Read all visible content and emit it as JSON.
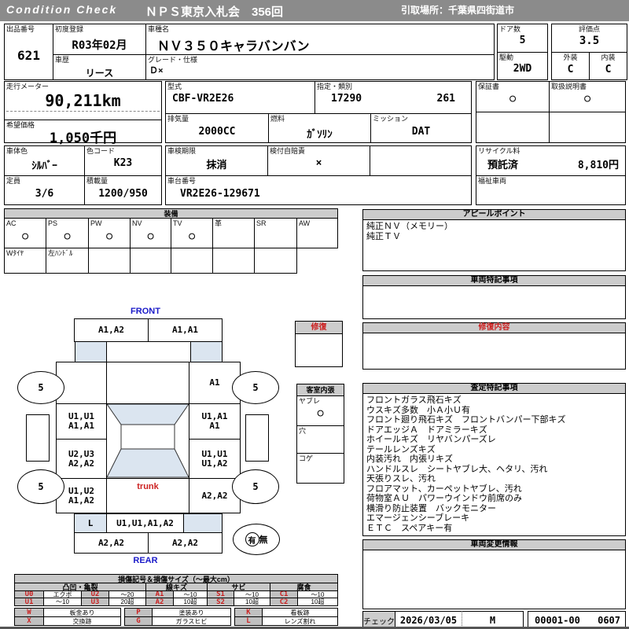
{
  "colors": {
    "header_bg": "#8b8b8b",
    "section_header_bg": "#cccccc",
    "diagram_highlight": "#dbe5f0",
    "accent_red": "#cc2222",
    "accent_blue": "#1a1ac8"
  },
  "header": {
    "logo": "Condition Check",
    "title": "ＮＰＳ東京入札会　356回",
    "pickup": "引取場所：千葉県四街道市"
  },
  "info": {
    "lot_no_label": "出品番号",
    "lot_no": "621",
    "first_reg_label": "初度登録",
    "first_reg": "R03年02月",
    "history_label": "車歴",
    "history": "リース",
    "model_label": "車種名",
    "model": "ＮＶ３５０キャラバンバン",
    "grade_label": "グレード・仕様",
    "grade": "Ｄ×",
    "doors_label": "ドア数",
    "doors": "5",
    "score_label": "評価点",
    "score": "3.5",
    "drive_label": "駆動",
    "drive": "2WD",
    "exterior_label": "外装",
    "exterior": "C",
    "interior_label": "内装",
    "interior": "C",
    "odometer_label": "走行メーター",
    "odometer": "90,211km",
    "price_label": "希望価格",
    "price": "1,050千円",
    "model_code_label": "型式",
    "model_code": "CBF-VR2E26",
    "class_label": "指定・類別",
    "class_no": "17290",
    "class_sub": "261",
    "displacement_label": "排気量",
    "displacement": "2000CC",
    "fuel_label": "燃料",
    "fuel": "ｶﾞｿﾘﾝ",
    "mission_label": "ミッション",
    "mission": "DAT",
    "warranty_label": "保証書",
    "warranty": "○",
    "manual_label": "取扱説明書",
    "manual": "○",
    "body_color_label": "車体色",
    "body_color": "ｼﾙﾊﾞｰ",
    "color_code_label": "色コード",
    "color_code": "K23",
    "capacity_label": "定員",
    "capacity": "3/6",
    "load_label": "積載量",
    "load": "1200/950",
    "inspection_label": "車検期限",
    "inspection": "抹消",
    "insurance_label": "検付自賠責",
    "insurance": "×",
    "chassis_label": "車台番号",
    "chassis": "VR2E26-129671",
    "recycle_label": "リサイクル料",
    "recycle_status": "預託済",
    "recycle_fee": "8,810円",
    "welfare_label": "福祉車両"
  },
  "equipment": {
    "title": "装備",
    "items": [
      {
        "label": "AC",
        "value": "○"
      },
      {
        "label": "PS",
        "value": "○"
      },
      {
        "label": "PW",
        "value": "○"
      },
      {
        "label": "NV",
        "value": "○"
      },
      {
        "label": "TV",
        "value": "○"
      },
      {
        "label": "革",
        "value": ""
      },
      {
        "label": "SR",
        "value": ""
      },
      {
        "label": "AW",
        "value": ""
      }
    ],
    "extras": [
      "Wﾀｲﾔ",
      "左ﾊﾝﾄﾞﾙ",
      "",
      "",
      "",
      "",
      ""
    ]
  },
  "sections": {
    "appeal": {
      "title": "アピールポイント",
      "lines": [
        "純正ＮＶ（メモリー）",
        "純正ＴＶ"
      ]
    },
    "notes": {
      "title": "車両特記事項"
    },
    "repair": {
      "title": "修復内容"
    },
    "assessment": {
      "title": "査定特記事項",
      "lines": [
        "フロントガラス飛石キズ",
        "ウスキズ多数　小Ａ小Ｕ有",
        "フロント廻り飛石キズ　フロントバンパー下部キズ",
        "ドアエッジＡ　ドアミラーキズ",
        "ホイールキズ　リヤバンパーズレ",
        "テールレンズキズ",
        "内装汚れ　内張リキズ",
        "ハンドルスレ　シートヤブレ大、ヘタリ、汚れ",
        "天張りスレ、汚れ",
        "フロアマット、カーペットヤブレ、汚れ",
        "荷物室ＡＵ　パワーウインドウ前席のみ",
        "横滑り防止装置　バックモニター",
        "エマージェンシーブレーキ",
        "ＥＴＣ　スペアキー有"
      ]
    },
    "changes": {
      "title": "車両変更情報"
    }
  },
  "diagram": {
    "front_label": "FRONT",
    "rear_label": "REAR",
    "trunk_label": "trunk",
    "wheels": [
      "5",
      "5",
      "5",
      "5"
    ],
    "front_bumper_left": "A1,A2",
    "front_bumper_right": "A1,A1",
    "fender_left": "",
    "fender_right": "A1",
    "side_left_front": "U1,U1\nA1,A1",
    "side_left_mid": "U2,U3\nA2,A2",
    "side_left_rear": "U1,U2\nA1,A2",
    "side_right_front": "U1,A1\nA1",
    "side_right_mid": "U1,U1\nU1,A2",
    "side_right_rear": "A2,A2",
    "tailgate_left": "L",
    "tailgate_center": "U1,U1,A1,A2",
    "rear_bumper_left": "A2,A2",
    "rear_bumper_right": "A2,A2",
    "spare_yes": "有",
    "spare_no": "無"
  },
  "repair_mark_box": {
    "title": "修復"
  },
  "cabin_lining": {
    "title": "客室内張",
    "rows": [
      {
        "label": "ヤブレ",
        "value": "○"
      },
      {
        "label": "穴",
        "value": ""
      },
      {
        "label": "コゲ",
        "value": ""
      }
    ]
  },
  "legend": {
    "title": "損傷記号＆損傷サイズ（～最大cm）",
    "groups": [
      "凸凹・亀裂",
      "線キズ",
      "サビ",
      "腐食"
    ],
    "row1": [
      {
        "c": "U0",
        "v": "エクボ"
      },
      {
        "c": "U2",
        "v": "～20"
      },
      {
        "c": "A1",
        "v": "～10"
      },
      {
        "c": "S1",
        "v": "～10"
      },
      {
        "c": "C1",
        "v": "～10"
      }
    ],
    "row2": [
      {
        "c": "U1",
        "v": "～10"
      },
      {
        "c": "U3",
        "v": "20超"
      },
      {
        "c": "A2",
        "v": "10超"
      },
      {
        "c": "S2",
        "v": "10超"
      },
      {
        "c": "C2",
        "v": "10超"
      }
    ],
    "marks_row1": [
      {
        "c": "W",
        "v": "板金あり"
      },
      {
        "c": "P",
        "v": "塗装あり"
      },
      {
        "c": "K",
        "v": "看板跡"
      }
    ],
    "marks_row2": [
      {
        "c": "X",
        "v": "交換跡"
      },
      {
        "c": "G",
        "v": "ガラスヒビ"
      },
      {
        "c": "L",
        "v": "レンズ割れ"
      }
    ]
  },
  "check": {
    "label": "チェック",
    "date": "2026/03/05",
    "inspector": "M",
    "sheet_no": "00001-00",
    "code": "0607"
  }
}
